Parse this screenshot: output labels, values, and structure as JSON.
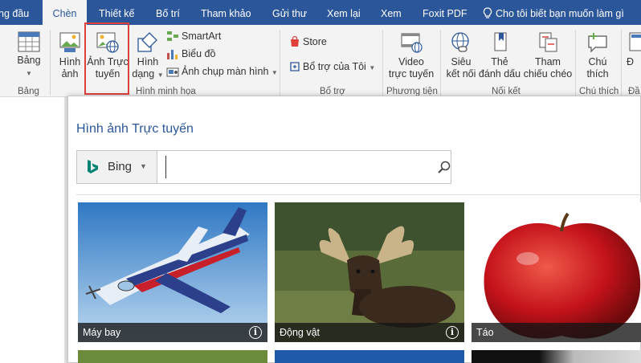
{
  "tabs": [
    {
      "label": "ng đầu"
    },
    {
      "label": "Chèn",
      "active": true
    },
    {
      "label": "Thiết kế"
    },
    {
      "label": "Bố trí"
    },
    {
      "label": "Tham khảo"
    },
    {
      "label": "Gửi thư"
    },
    {
      "label": "Xem lại"
    },
    {
      "label": "Xem"
    },
    {
      "label": "Foxit PDF"
    }
  ],
  "tell_me": "Cho tôi biết bạn muốn làm gì",
  "ribbon": {
    "table_group": {
      "button": "Bảng",
      "label": "Bảng"
    },
    "illustrations_group": {
      "picture": [
        "Hình",
        "ảnh"
      ],
      "online_picture": [
        "Ảnh Trực",
        "tuyến"
      ],
      "shapes": [
        "Hình",
        "dạng"
      ],
      "smartart": "SmartArt",
      "chart": "Biểu đồ",
      "screenshot": "Ảnh chụp màn hình",
      "label": "Hình minh họa"
    },
    "addins_group": {
      "store": "Store",
      "my_addins": "Bổ trợ của Tôi",
      "label": "Bổ trợ"
    },
    "media_group": {
      "video": [
        "Video",
        "trực tuyến"
      ],
      "label": "Phương tiện"
    },
    "links_group": {
      "hyperlink": [
        "Siêu",
        "kết nối"
      ],
      "bookmark": [
        "Thẻ",
        "đánh dấu"
      ],
      "cross_reference": [
        "Tham",
        "chiếu chéo"
      ],
      "label": "Nối kết"
    },
    "comments_group": {
      "comment": [
        "Chú",
        "thích"
      ],
      "label": "Chú thích"
    },
    "header_group": {
      "partial_label": "Đ",
      "partial_group": "Đầ"
    }
  },
  "dialog": {
    "title": "Hình ảnh Trực tuyến",
    "provider": "Bing",
    "search_value": "",
    "tiles": [
      {
        "label": "Máy bay"
      },
      {
        "label": "Động vật"
      },
      {
        "label": "Táo"
      }
    ],
    "info_glyph": "i"
  },
  "colors": {
    "accent": "#2b579a",
    "highlight": "#e0403a",
    "bing": "#008373"
  }
}
